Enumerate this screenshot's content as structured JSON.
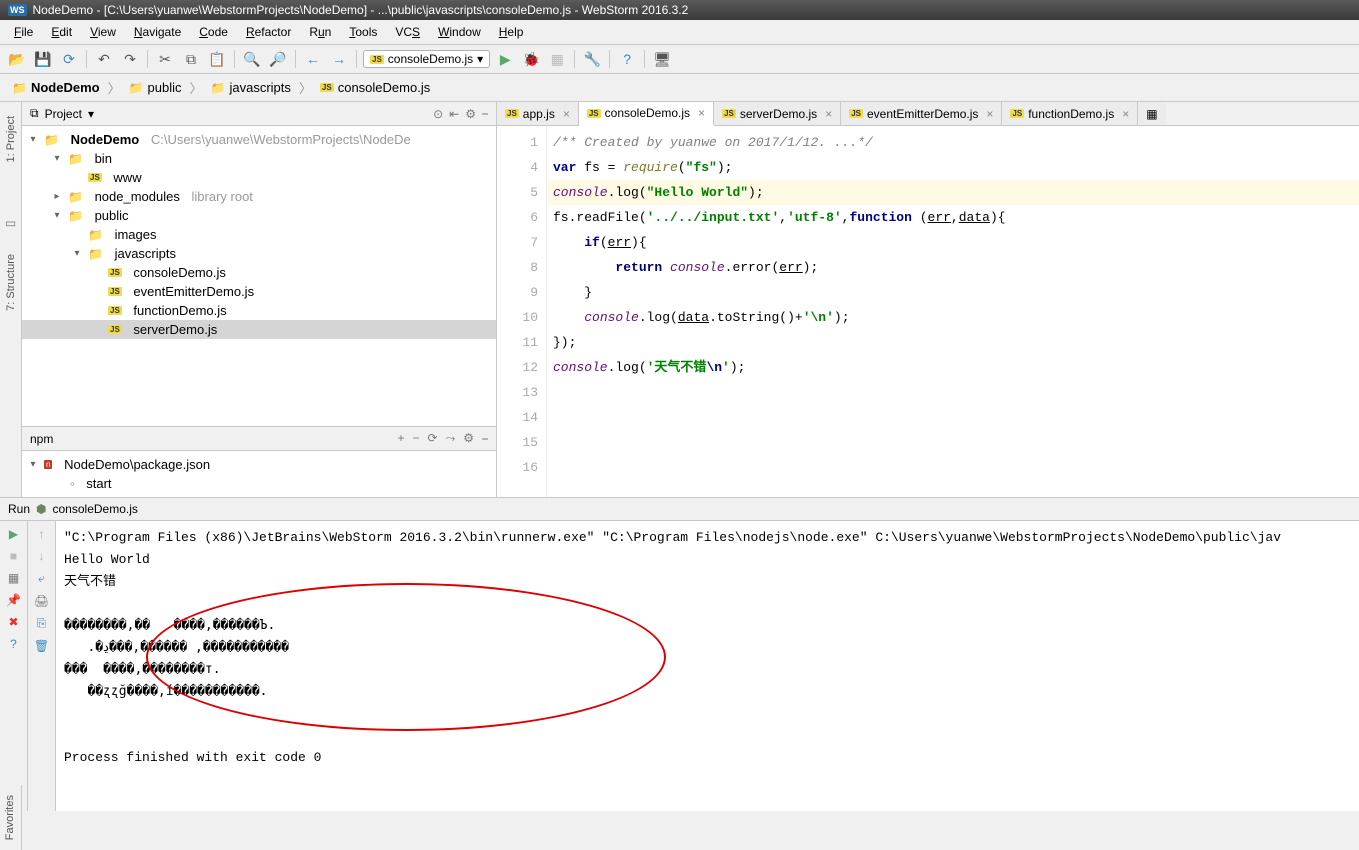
{
  "window": {
    "title": "NodeDemo - [C:\\Users\\yuanwe\\WebstormProjects\\NodeDemo] - ...\\public\\javascripts\\consoleDemo.js - WebStorm 2016.3.2"
  },
  "menu": [
    "File",
    "Edit",
    "View",
    "Navigate",
    "Code",
    "Refactor",
    "Run",
    "Tools",
    "VCS",
    "Window",
    "Help"
  ],
  "runConfig": "consoleDemo.js",
  "breadcrumb": [
    "NodeDemo",
    "public",
    "javascripts",
    "consoleDemo.js"
  ],
  "projectPanel": {
    "title": "Project"
  },
  "tree": {
    "root": "NodeDemo",
    "rootPath": "C:\\Users\\yuanwe\\WebstormProjects\\NodeDe",
    "bin": "bin",
    "www": "www",
    "node_modules": "node_modules",
    "libroot": "library root",
    "public": "public",
    "images": "images",
    "javascripts": "javascripts",
    "f1": "consoleDemo.js",
    "f2": "eventEmitterDemo.js",
    "f3": "functionDemo.js",
    "f4": "serverDemo.js"
  },
  "npm": {
    "title": "npm",
    "pkg": "NodeDemo\\package.json",
    "script": "start"
  },
  "tabs": [
    "app.js",
    "consoleDemo.js",
    "serverDemo.js",
    "eventEmitterDemo.js",
    "functionDemo.js"
  ],
  "activeTab": 1,
  "gutter": [
    "1",
    "4",
    "5",
    "6",
    "7",
    "8",
    "9",
    "10",
    "11",
    "12",
    "13",
    "14",
    "15",
    "16"
  ],
  "code": {
    "l1a": "/** Created by yuanwe on 2017/1/12. ...*/",
    "l4_var": "var",
    "l4_fs": " fs = ",
    "l4_req": "require",
    "l4_str": "\"fs\"",
    "l5_con": "console",
    "l5_log": ".log(",
    "l5_str": "\"Hello World\"",
    "l6_fs": "fs.readFile(",
    "l6_s1": "'../../input.txt'",
    "l6_c": ",",
    "l6_s2": "'utf-8'",
    "l6_fn": "function",
    "l6_p1": "err",
    "l6_p2": "data",
    "l7_if": "if",
    "l7_err": "err",
    "l8_ret": "return",
    "l8_con": "console",
    "l8_err": ".error(",
    "l8_p": "err",
    "l10_con": "console",
    "l10_log": ".log(",
    "l10_data": "data",
    "l10_ts": ".toString()+",
    "l10_nl": "'\\n'",
    "l12_con": "console",
    "l12_log": ".log(",
    "l12_str": "'天气不错",
    "l12_nl": "\\n",
    "l12_end": "'"
  },
  "run": {
    "title": "Run",
    "config": "consoleDemo.js",
    "cmd": "\"C:\\Program Files (x86)\\JetBrains\\WebStorm 2016.3.2\\bin\\runnerw.exe\" \"C:\\Program Files\\nodejs\\node.exe\" C:\\Users\\yuanwe\\WebstormProjects\\NodeDemo\\public\\jav",
    "out1": "Hello World",
    "out2": "天气不错",
    "g1": "��������,��   ����,������Ъ.",
    "g2": "   .�ڍ���,������ ,�����������",
    "g3": "���  ����,��������т.",
    "g4": "   ��ʐʐğ����,í�����������.",
    "exit": "Process finished with exit code 0"
  },
  "edges": {
    "project": "1: Project",
    "structure": "7: Structure",
    "fav": "Favorites"
  }
}
